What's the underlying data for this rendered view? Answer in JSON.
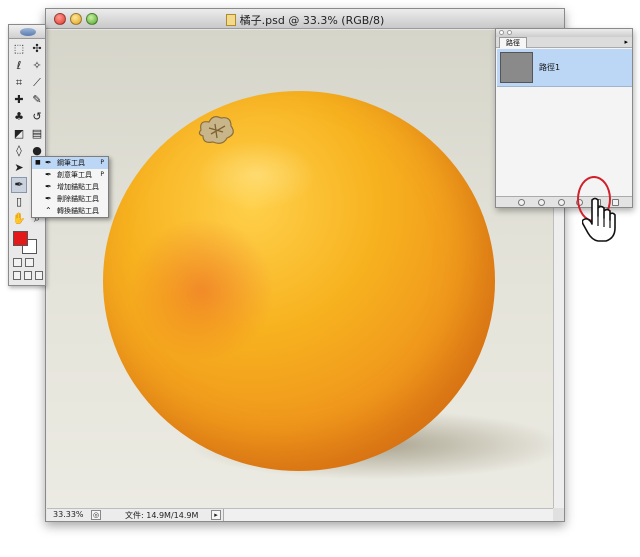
{
  "document": {
    "title": "橘子.psd @ 33.3% (RGB/8)",
    "zoom": "33.33%",
    "file_info": "文件: 14.9M/14.9M"
  },
  "flyout": {
    "items": [
      {
        "label": "鋼筆工具",
        "shortcut": "P",
        "selected": true
      },
      {
        "label": "創意筆工具",
        "shortcut": "P",
        "selected": false
      },
      {
        "label": "增加錨點工具",
        "shortcut": "",
        "selected": false
      },
      {
        "label": "刪除錨點工具",
        "shortcut": "",
        "selected": false
      },
      {
        "label": "轉換錨點工具",
        "shortcut": "",
        "selected": false
      }
    ]
  },
  "paths_panel": {
    "tab_label": "路徑",
    "paths": [
      {
        "name": "路徑1"
      }
    ]
  },
  "colors": {
    "foreground": "#e21a1a",
    "background": "#ffffff",
    "highlight_ring": "#d0202a"
  }
}
